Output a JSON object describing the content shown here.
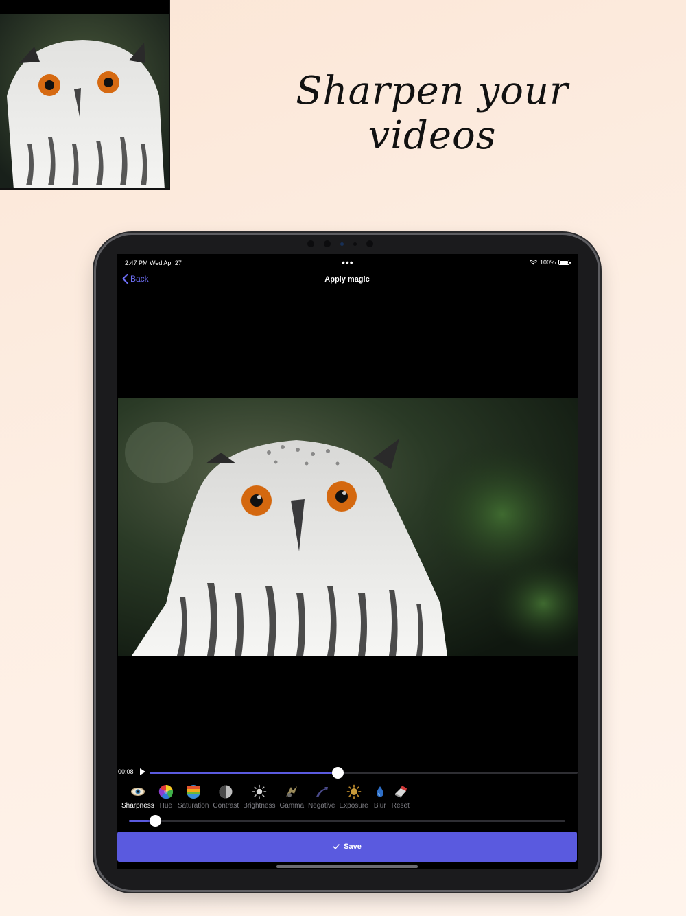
{
  "hero": {
    "headline": "Sharpen your videos"
  },
  "status_bar": {
    "time": "2:47 PM  Wed Apr 27",
    "more": "•••",
    "battery": "100%"
  },
  "nav": {
    "back_label": "Back",
    "title": "Apply magic"
  },
  "player": {
    "timecode": "00:08",
    "progress": 0.44
  },
  "tools": [
    {
      "label": "Sharpness",
      "icon": "eye-icon",
      "active": true
    },
    {
      "label": "Hue",
      "icon": "color-wheel-icon",
      "active": false
    },
    {
      "label": "Saturation",
      "icon": "rainbow-icon",
      "active": false
    },
    {
      "label": "Contrast",
      "icon": "contrast-icon",
      "active": false
    },
    {
      "label": "Brightness",
      "icon": "sun-icon",
      "active": false
    },
    {
      "label": "Gamma",
      "icon": "gamma-icon",
      "active": false
    },
    {
      "label": "Negative",
      "icon": "negative-icon",
      "active": false
    },
    {
      "label": "Exposure",
      "icon": "exposure-icon",
      "active": false
    },
    {
      "label": "Blur",
      "icon": "water-drop-icon",
      "active": false
    },
    {
      "label": "Reset",
      "icon": "eraser-icon",
      "active": false
    }
  ],
  "adjust": {
    "value": 0.06
  },
  "save": {
    "label": "Save"
  },
  "colors": {
    "accent": "#5a5adf",
    "link": "#6d6ef5"
  }
}
